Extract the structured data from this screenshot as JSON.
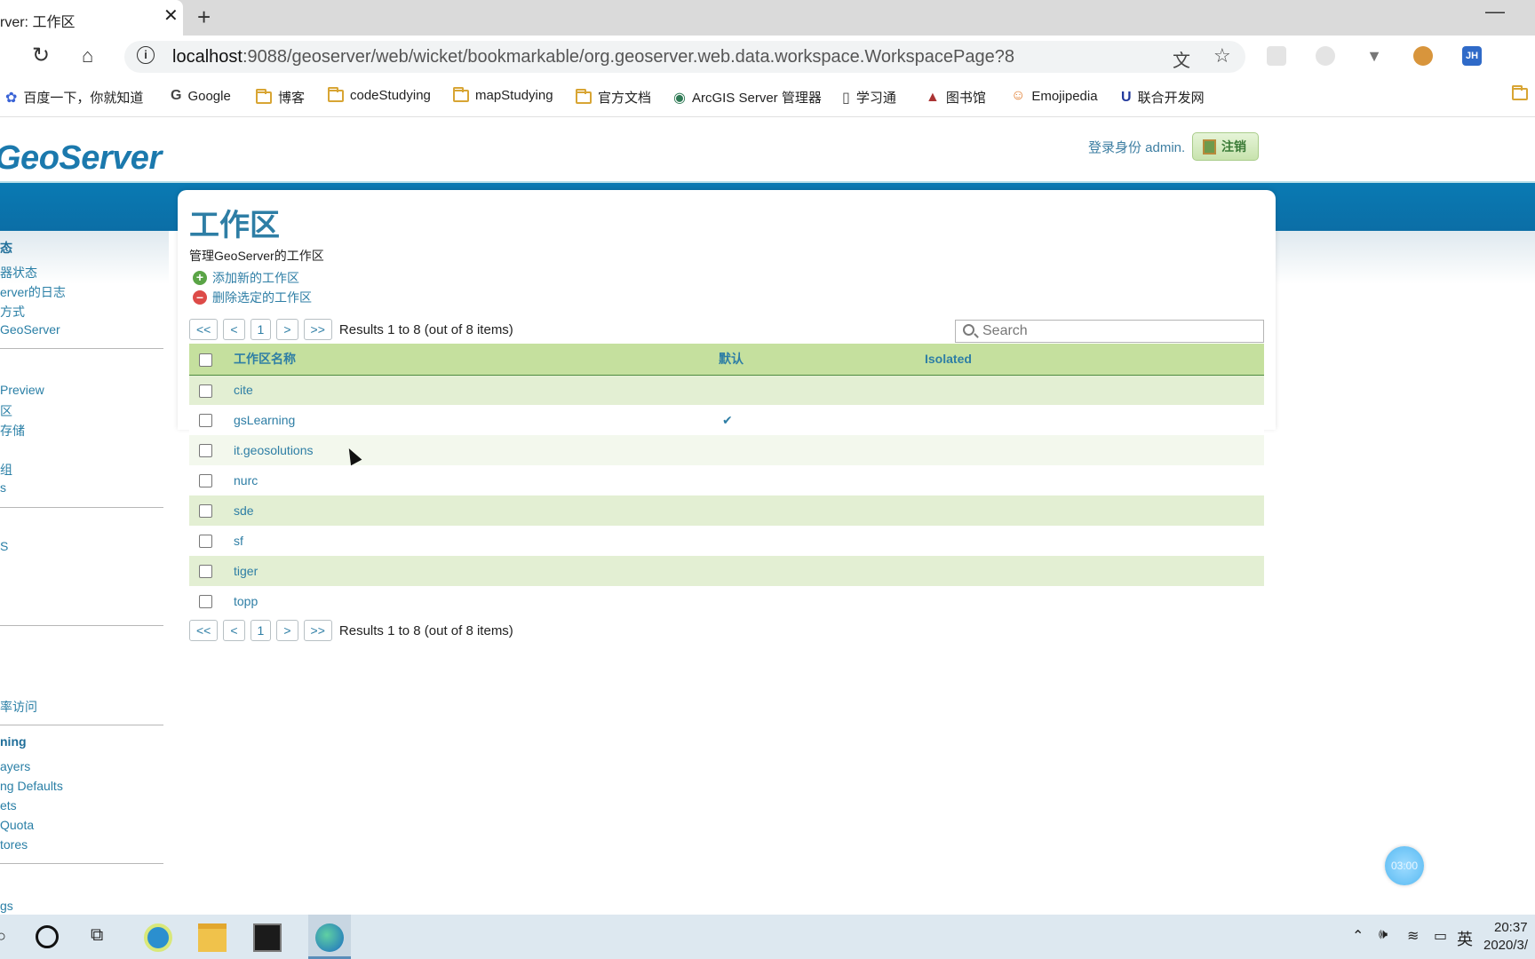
{
  "browser": {
    "tab_title": "rver: 工作区",
    "url_host": "localhost",
    "url_path": ":9088/geoserver/web/wicket/bookmarkable/org.geoserver.web.data.workspace.WorkspacePage?8",
    "bookmarks": [
      "百度一下，你就知道",
      "Google",
      "博客",
      "codeStudying",
      "mapStudying",
      "官方文档",
      "ArcGIS Server 管理器",
      "学习通",
      "图书馆",
      "Emojipedia",
      "联合开发网"
    ],
    "extension_label": "JH"
  },
  "header": {
    "logo": "GeoServer",
    "login_text": "登录身份 admin.",
    "logout_label": "注销"
  },
  "sidebar": {
    "items": [
      "态",
      "器状态",
      "erver的日志",
      "方式",
      "GeoServer",
      "Preview",
      "区",
      "存储",
      "组",
      "s",
      "S",
      "率访问",
      "ning",
      "ayers",
      "ng Defaults",
      "ets",
      "Quota",
      "tores",
      "gs"
    ]
  },
  "content": {
    "title": "工作区",
    "description": "管理GeoServer的工作区",
    "add_label": "添加新的工作区",
    "delete_label": "删除选定的工作区",
    "pager": {
      "first": "<<",
      "prev": "<",
      "page": "1",
      "next": ">",
      "last": ">>",
      "info": "Results 1 to 8 (out of 8 items)"
    },
    "search_placeholder": "Search",
    "columns": {
      "name": "工作区名称",
      "default": "默认",
      "isolated": "Isolated"
    },
    "rows": [
      {
        "name": "cite",
        "default": ""
      },
      {
        "name": "gsLearning",
        "default": "✔"
      },
      {
        "name": "it.geosolutions",
        "default": ""
      },
      {
        "name": "nurc",
        "default": ""
      },
      {
        "name": "sde",
        "default": ""
      },
      {
        "name": "sf",
        "default": ""
      },
      {
        "name": "tiger",
        "default": ""
      },
      {
        "name": "topp",
        "default": ""
      }
    ]
  },
  "overlay": {
    "timer": "03:00"
  },
  "taskbar": {
    "ime": "英",
    "time": "20:37",
    "date": "2020/3/"
  },
  "colors": {
    "accent": "#2e7ea5",
    "header_band": "#0b74ad",
    "row_green": "#e3efd3",
    "table_header": "#c5e09e"
  }
}
